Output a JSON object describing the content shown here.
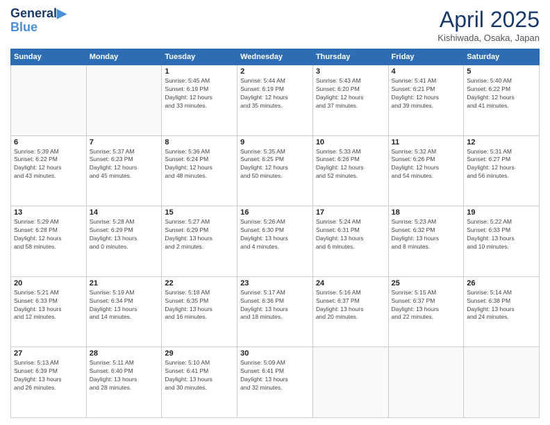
{
  "header": {
    "logo_line1": "General",
    "logo_line2": "Blue",
    "month": "April 2025",
    "location": "Kishiwada, Osaka, Japan"
  },
  "days_of_week": [
    "Sunday",
    "Monday",
    "Tuesday",
    "Wednesday",
    "Thursday",
    "Friday",
    "Saturday"
  ],
  "weeks": [
    [
      {
        "day": "",
        "info": ""
      },
      {
        "day": "",
        "info": ""
      },
      {
        "day": "1",
        "info": "Sunrise: 5:45 AM\nSunset: 6:19 PM\nDaylight: 12 hours\nand 33 minutes."
      },
      {
        "day": "2",
        "info": "Sunrise: 5:44 AM\nSunset: 6:19 PM\nDaylight: 12 hours\nand 35 minutes."
      },
      {
        "day": "3",
        "info": "Sunrise: 5:43 AM\nSunset: 6:20 PM\nDaylight: 12 hours\nand 37 minutes."
      },
      {
        "day": "4",
        "info": "Sunrise: 5:41 AM\nSunset: 6:21 PM\nDaylight: 12 hours\nand 39 minutes."
      },
      {
        "day": "5",
        "info": "Sunrise: 5:40 AM\nSunset: 6:22 PM\nDaylight: 12 hours\nand 41 minutes."
      }
    ],
    [
      {
        "day": "6",
        "info": "Sunrise: 5:39 AM\nSunset: 6:22 PM\nDaylight: 12 hours\nand 43 minutes."
      },
      {
        "day": "7",
        "info": "Sunrise: 5:37 AM\nSunset: 6:23 PM\nDaylight: 12 hours\nand 45 minutes."
      },
      {
        "day": "8",
        "info": "Sunrise: 5:36 AM\nSunset: 6:24 PM\nDaylight: 12 hours\nand 48 minutes."
      },
      {
        "day": "9",
        "info": "Sunrise: 5:35 AM\nSunset: 6:25 PM\nDaylight: 12 hours\nand 50 minutes."
      },
      {
        "day": "10",
        "info": "Sunrise: 5:33 AM\nSunset: 6:26 PM\nDaylight: 12 hours\nand 52 minutes."
      },
      {
        "day": "11",
        "info": "Sunrise: 5:32 AM\nSunset: 6:26 PM\nDaylight: 12 hours\nand 54 minutes."
      },
      {
        "day": "12",
        "info": "Sunrise: 5:31 AM\nSunset: 6:27 PM\nDaylight: 12 hours\nand 56 minutes."
      }
    ],
    [
      {
        "day": "13",
        "info": "Sunrise: 5:29 AM\nSunset: 6:28 PM\nDaylight: 12 hours\nand 58 minutes."
      },
      {
        "day": "14",
        "info": "Sunrise: 5:28 AM\nSunset: 6:29 PM\nDaylight: 13 hours\nand 0 minutes."
      },
      {
        "day": "15",
        "info": "Sunrise: 5:27 AM\nSunset: 6:29 PM\nDaylight: 13 hours\nand 2 minutes."
      },
      {
        "day": "16",
        "info": "Sunrise: 5:26 AM\nSunset: 6:30 PM\nDaylight: 13 hours\nand 4 minutes."
      },
      {
        "day": "17",
        "info": "Sunrise: 5:24 AM\nSunset: 6:31 PM\nDaylight: 13 hours\nand 6 minutes."
      },
      {
        "day": "18",
        "info": "Sunrise: 5:23 AM\nSunset: 6:32 PM\nDaylight: 13 hours\nand 8 minutes."
      },
      {
        "day": "19",
        "info": "Sunrise: 5:22 AM\nSunset: 6:33 PM\nDaylight: 13 hours\nand 10 minutes."
      }
    ],
    [
      {
        "day": "20",
        "info": "Sunrise: 5:21 AM\nSunset: 6:33 PM\nDaylight: 13 hours\nand 12 minutes."
      },
      {
        "day": "21",
        "info": "Sunrise: 5:19 AM\nSunset: 6:34 PM\nDaylight: 13 hours\nand 14 minutes."
      },
      {
        "day": "22",
        "info": "Sunrise: 5:18 AM\nSunset: 6:35 PM\nDaylight: 13 hours\nand 16 minutes."
      },
      {
        "day": "23",
        "info": "Sunrise: 5:17 AM\nSunset: 6:36 PM\nDaylight: 13 hours\nand 18 minutes."
      },
      {
        "day": "24",
        "info": "Sunrise: 5:16 AM\nSunset: 6:37 PM\nDaylight: 13 hours\nand 20 minutes."
      },
      {
        "day": "25",
        "info": "Sunrise: 5:15 AM\nSunset: 6:37 PM\nDaylight: 13 hours\nand 22 minutes."
      },
      {
        "day": "26",
        "info": "Sunrise: 5:14 AM\nSunset: 6:38 PM\nDaylight: 13 hours\nand 24 minutes."
      }
    ],
    [
      {
        "day": "27",
        "info": "Sunrise: 5:13 AM\nSunset: 6:39 PM\nDaylight: 13 hours\nand 26 minutes."
      },
      {
        "day": "28",
        "info": "Sunrise: 5:11 AM\nSunset: 6:40 PM\nDaylight: 13 hours\nand 28 minutes."
      },
      {
        "day": "29",
        "info": "Sunrise: 5:10 AM\nSunset: 6:41 PM\nDaylight: 13 hours\nand 30 minutes."
      },
      {
        "day": "30",
        "info": "Sunrise: 5:09 AM\nSunset: 6:41 PM\nDaylight: 13 hours\nand 32 minutes."
      },
      {
        "day": "",
        "info": ""
      },
      {
        "day": "",
        "info": ""
      },
      {
        "day": "",
        "info": ""
      }
    ]
  ]
}
